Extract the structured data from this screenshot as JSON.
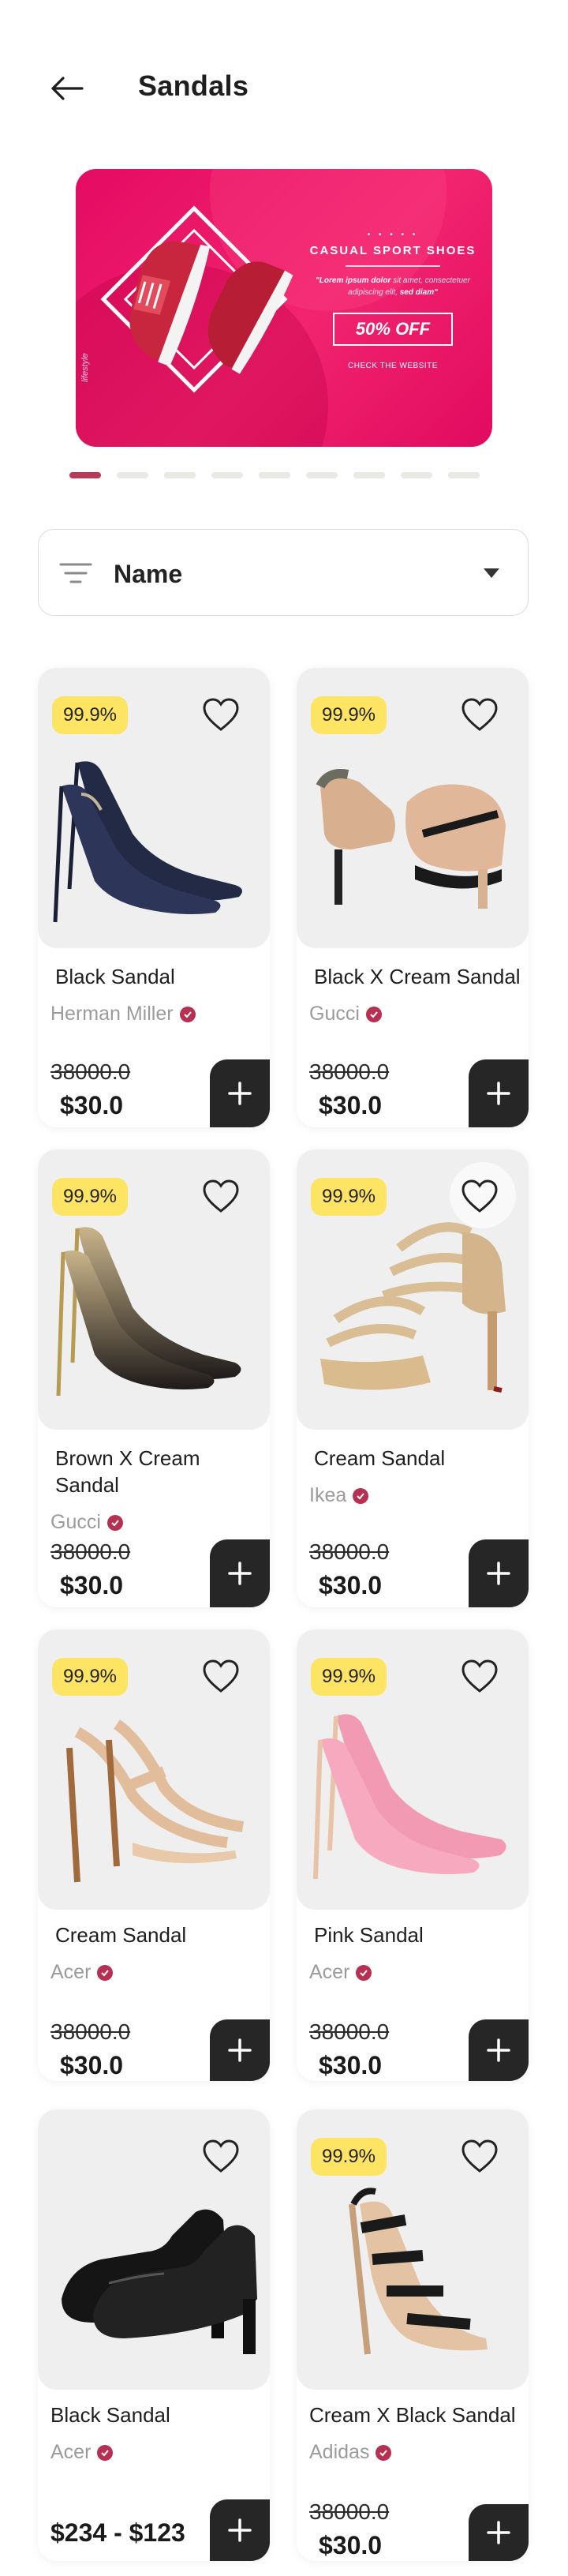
{
  "header": {
    "title": "Sandals",
    "back_icon": "arrow-left-icon"
  },
  "banner": {
    "dots": "• • • • •",
    "heading": "CASUAL SPORT SHOES",
    "desc_bold1": "\"Lorem ipsum dolor",
    "desc_mid": " sit amet, consectetuer adipiscing elit, ",
    "desc_bold2": "sed diam\"",
    "offer": "50% OFF",
    "cta": "CHECK THE WEBSITE",
    "vertical_text": "lifestyle",
    "colors": {
      "accent": "#e40b63"
    }
  },
  "pager": {
    "count": 9,
    "active_index": 0,
    "active_color": "#b83958"
  },
  "sort": {
    "label": "Name",
    "icon": "filter-lines-icon",
    "caret": "caret-down-icon"
  },
  "products": [
    {
      "badge": "99.9%",
      "name": "Black Sandal",
      "brand": "Herman Miller",
      "old_price": "38000.0",
      "price": "$30.0"
    },
    {
      "badge": "99.9%",
      "name": "Black X Cream Sandal",
      "brand": "Gucci",
      "old_price": "38000.0",
      "price": "$30.0"
    },
    {
      "badge": "99.9%",
      "name": "Brown X Cream Sandal",
      "brand": "Gucci",
      "old_price": "38000.0",
      "price": "$30.0"
    },
    {
      "badge": "99.9%",
      "name": "Cream Sandal",
      "brand": "Ikea",
      "old_price": "38000.0",
      "price": "$30.0"
    },
    {
      "badge": "99.9%",
      "name": "Cream Sandal",
      "brand": "Acer",
      "old_price": "38000.0",
      "price": "$30.0"
    },
    {
      "badge": "99.9%",
      "name": "Pink Sandal",
      "brand": "Acer",
      "old_price": "38000.0",
      "price": "$30.0"
    },
    {
      "badge": "",
      "name": "Black Sandal",
      "brand": "Acer",
      "old_price": "",
      "price": "$234 - $123"
    },
    {
      "badge": "99.9%",
      "name": "Cream X Black Sandal",
      "brand": "Adidas",
      "old_price": "38000.0",
      "price": "$30.0"
    }
  ]
}
